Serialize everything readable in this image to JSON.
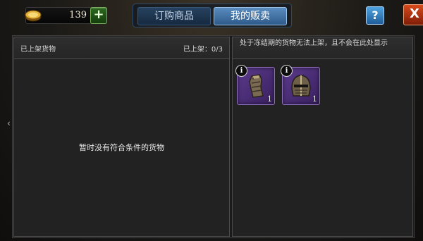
{
  "currency": {
    "amount": "139",
    "add_label": "+"
  },
  "tabs": [
    {
      "label": "订购商品",
      "active": false
    },
    {
      "label": "我的贩卖",
      "active": true
    }
  ],
  "buttons": {
    "help": "?",
    "close": "X"
  },
  "left_panel": {
    "title": "已上架货物",
    "count": "已上架：0/3",
    "empty_message": "暂时没有符合条件的货物"
  },
  "right_panel": {
    "notice": "处于冻结期的货物无法上架，且不会在此处显示",
    "items": [
      {
        "icon": "gauntlet-armor-icon",
        "quantity": "1"
      },
      {
        "icon": "helmet-armor-icon",
        "quantity": "1"
      }
    ]
  },
  "colors": {
    "tab_active": "#5a8cbf",
    "item_rarity_purple": "#5b3a8c",
    "add_green": "#2c6a1f",
    "close_red": "#d94a1b"
  }
}
